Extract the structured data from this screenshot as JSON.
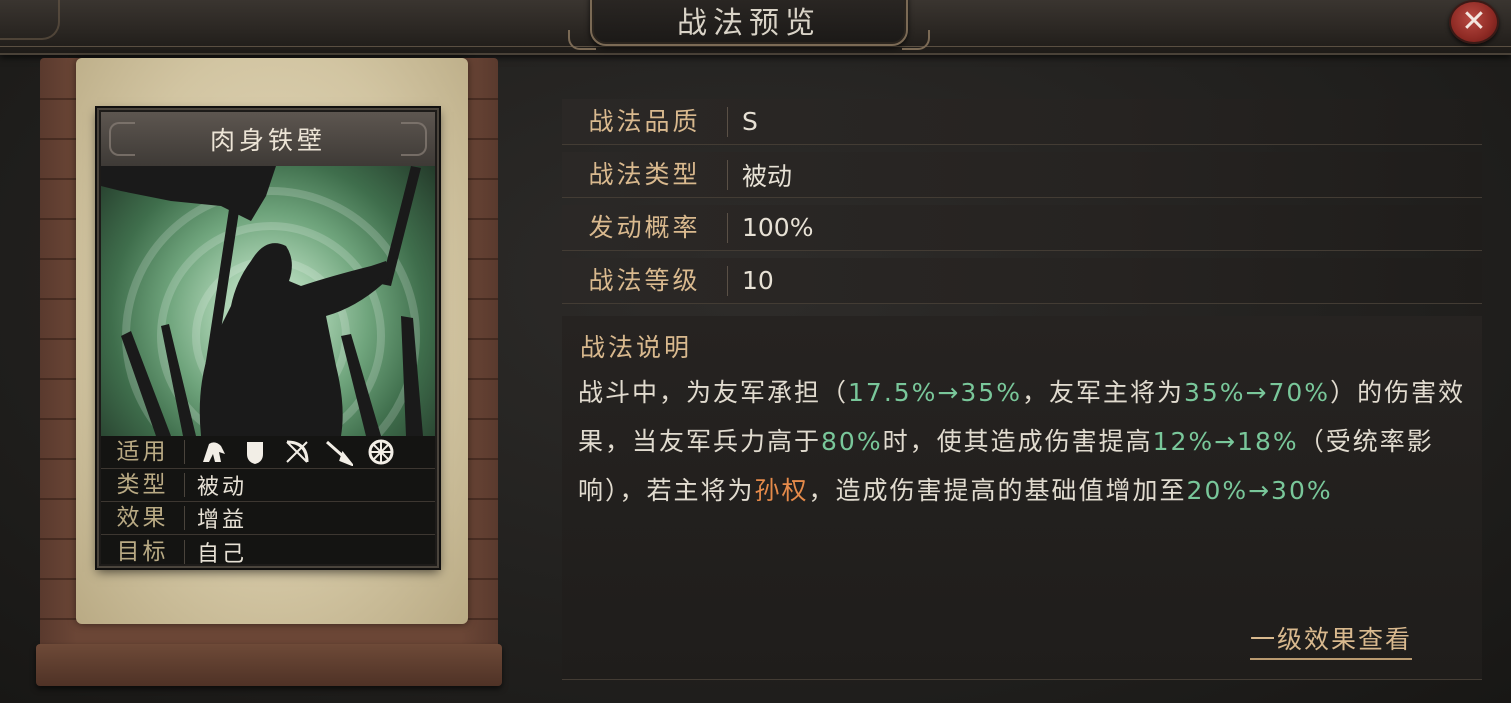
{
  "window": {
    "title": "战法预览",
    "close_label": "✕"
  },
  "card": {
    "name": "肉身铁壁",
    "info": [
      {
        "label": "适用",
        "icons": [
          "cavalry-icon",
          "shield-icon",
          "bow-icon",
          "spear-icon",
          "vehicle-icon"
        ]
      },
      {
        "label": "类型",
        "value": "被动"
      },
      {
        "label": "效果",
        "value": "增益"
      },
      {
        "label": "目标",
        "value": "自己"
      }
    ]
  },
  "stats": [
    {
      "label": "战法品质",
      "value": "S"
    },
    {
      "label": "战法类型",
      "value": "被动"
    },
    {
      "label": "发动概率",
      "value": "100%"
    },
    {
      "label": "战法等级",
      "value": "10"
    }
  ],
  "description": {
    "label": "战法说明",
    "segments": [
      {
        "text": "战斗中，为友军承担（",
        "style": "normal"
      },
      {
        "text": "17.5%→35%",
        "style": "green"
      },
      {
        "text": "，友军主将为",
        "style": "normal"
      },
      {
        "text": "35%→70%",
        "style": "green"
      },
      {
        "text": "）的伤害效果，当友军兵力高于",
        "style": "normal"
      },
      {
        "text": "80%",
        "style": "green"
      },
      {
        "text": "时，使其造成伤害提高",
        "style": "normal"
      },
      {
        "text": "12%→18%",
        "style": "green"
      },
      {
        "text": "（受统率影响），若主将为",
        "style": "normal"
      },
      {
        "text": "孙权",
        "style": "orange"
      },
      {
        "text": "，造成伤害提高的基础值增加至",
        "style": "normal"
      },
      {
        "text": "20%→30%",
        "style": "green"
      }
    ]
  },
  "link": {
    "label": "一级效果查看"
  },
  "colors": {
    "accent_gold": "#d9b98e",
    "highlight_green": "#79c79a",
    "highlight_orange": "#e58a4a",
    "close_red": "#a3362f"
  }
}
